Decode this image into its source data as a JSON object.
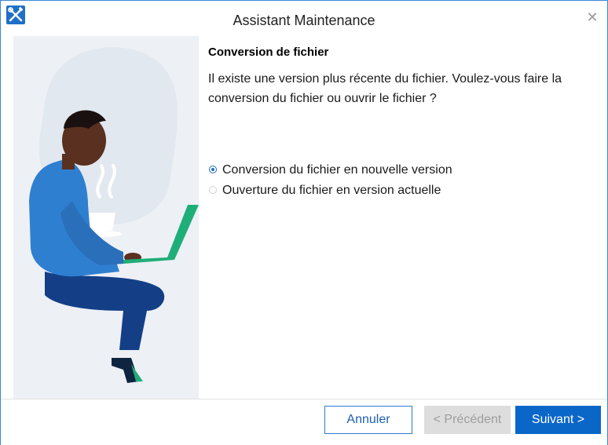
{
  "window": {
    "title": "Assistant Maintenance",
    "close_glyph": "✕",
    "app_icon": "wrench-screwdriver-icon"
  },
  "main": {
    "heading": "Conversion de fichier",
    "description": "Il existe une version plus récente du fichier. Voulez-vous faire la conversion du fichier ou ouvrir le fichier ?",
    "options": [
      {
        "label": "Conversion du fichier en nouvelle version",
        "selected": true
      },
      {
        "label": "Ouverture du fichier en version actuelle",
        "selected": false
      }
    ]
  },
  "illustration": {
    "subject": "person-with-laptop-illustration",
    "colors": {
      "shirt": "#2f7fd0",
      "pants": "#143f86",
      "laptop": "#1fae78",
      "skin": "#5a3020"
    }
  },
  "footer": {
    "cancel_label": "Annuler",
    "previous_label": "< Précédent",
    "next_label": "Suivant >"
  },
  "colors": {
    "accent": "#0a67c8",
    "border": "#3a86d8"
  }
}
